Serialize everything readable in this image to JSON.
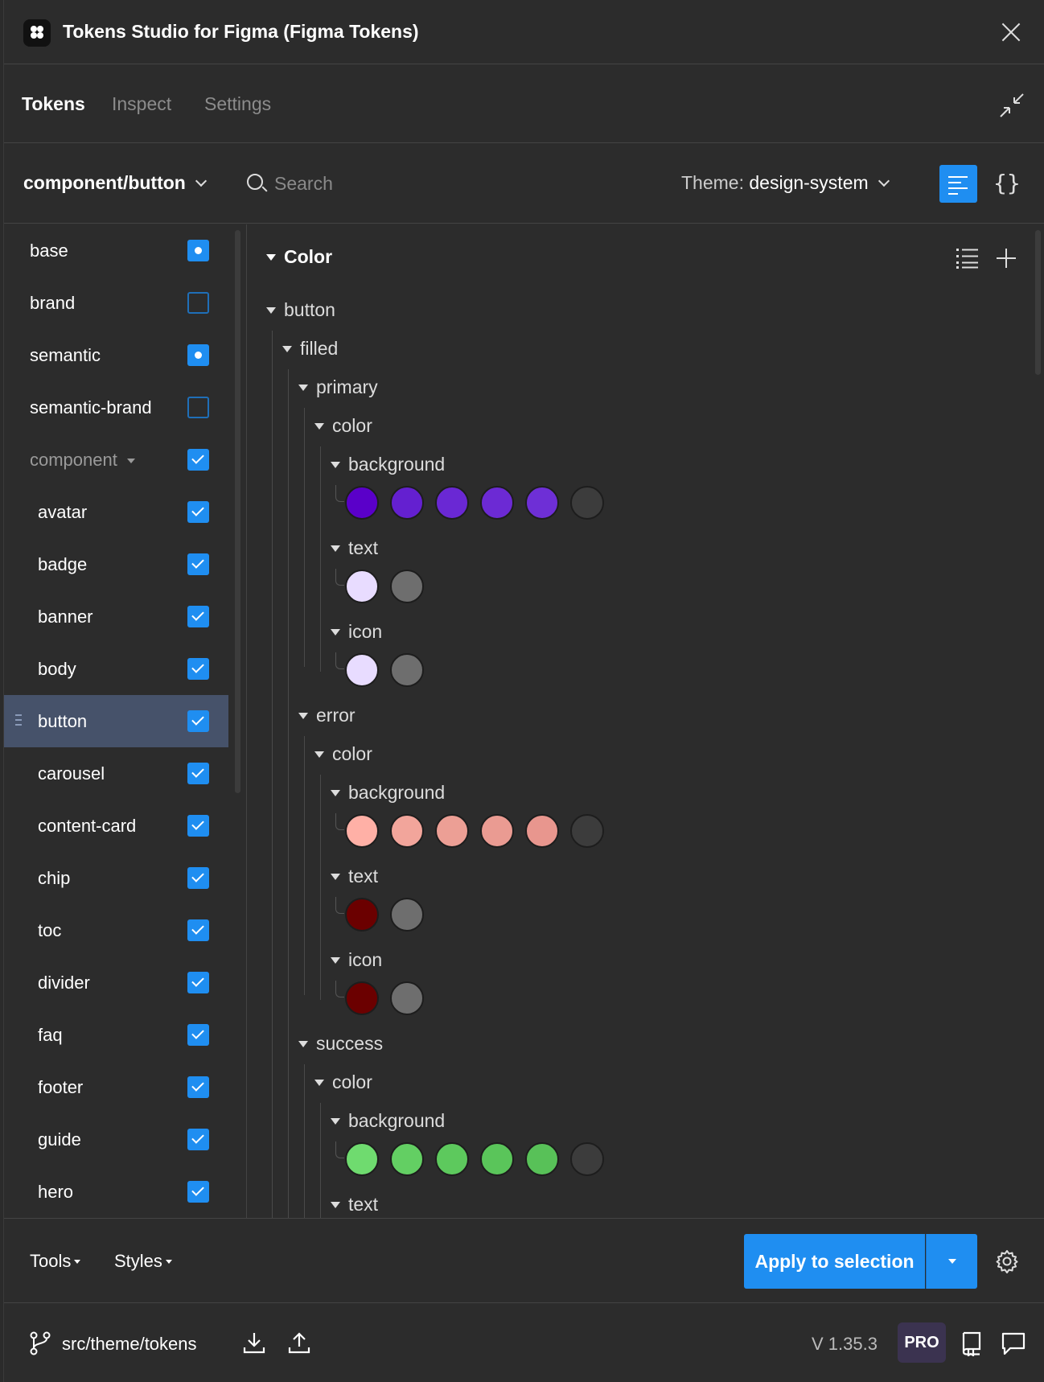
{
  "app": {
    "title": "Tokens Studio for Figma (Figma Tokens)"
  },
  "tabs": [
    {
      "label": "Tokens"
    },
    {
      "label": "Inspect"
    },
    {
      "label": "Settings"
    }
  ],
  "toolbar": {
    "token_set": "component/button",
    "search_placeholder": "Search",
    "theme_label": "Theme:",
    "theme_value": "design-system"
  },
  "sidebar": {
    "items": [
      {
        "label": "base",
        "state": "radio"
      },
      {
        "label": "brand",
        "state": "empty"
      },
      {
        "label": "semantic",
        "state": "radio"
      },
      {
        "label": "semantic-brand",
        "state": "empty"
      },
      {
        "label": "component",
        "state": "checked"
      },
      {
        "label": "avatar",
        "state": "checked"
      },
      {
        "label": "badge",
        "state": "checked"
      },
      {
        "label": "banner",
        "state": "checked"
      },
      {
        "label": "body",
        "state": "checked"
      },
      {
        "label": "button",
        "state": "checked"
      },
      {
        "label": "carousel",
        "state": "checked"
      },
      {
        "label": "content-card",
        "state": "checked"
      },
      {
        "label": "chip",
        "state": "checked"
      },
      {
        "label": "toc",
        "state": "checked"
      },
      {
        "label": "divider",
        "state": "checked"
      },
      {
        "label": "faq",
        "state": "checked"
      },
      {
        "label": "footer",
        "state": "checked"
      },
      {
        "label": "guide",
        "state": "checked"
      },
      {
        "label": "hero",
        "state": "checked"
      }
    ]
  },
  "tree": {
    "section": "Color",
    "nodes": {
      "button": "button",
      "filled": "filled",
      "primary": "primary",
      "error": "error",
      "success": "success",
      "color": "color",
      "background": "background",
      "text": "text",
      "icon": "icon"
    },
    "swatches": {
      "primary_background": [
        "#5a00c9",
        "#6420d0",
        "#6a28d4",
        "#6c2ad4",
        "#6e2fd6",
        "#3c3c3c"
      ],
      "primary_text": [
        "#e8dcff",
        "#6e6e6e"
      ],
      "primary_icon": [
        "#e8dcff",
        "#6e6e6e"
      ],
      "error_background": [
        "#ffb0a6",
        "#f2a59b",
        "#ec9f95",
        "#ea9b92",
        "#e8968e",
        "#3c3c3c"
      ],
      "error_text": [
        "#6b0000",
        "#6e6e6e"
      ],
      "error_icon": [
        "#6b0000",
        "#6e6e6e"
      ],
      "success_background": [
        "#6fdb6f",
        "#63cf63",
        "#5dc95d",
        "#5ac55a",
        "#58c158",
        "#3c3c3c"
      ]
    }
  },
  "actionbar": {
    "tools": "Tools",
    "styles": "Styles",
    "apply": "Apply to selection"
  },
  "footer": {
    "branch": "src/theme/tokens",
    "version": "V 1.35.3",
    "badge": "PRO"
  }
}
